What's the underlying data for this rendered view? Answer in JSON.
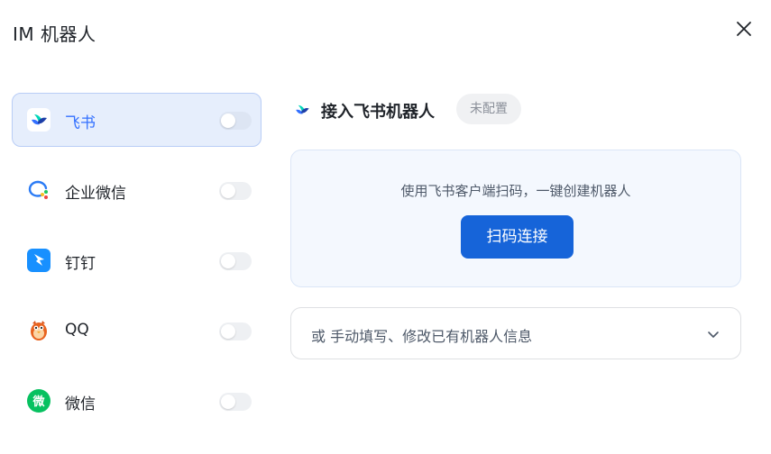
{
  "dialog": {
    "title": "IM 机器人",
    "close_icon": "close-icon"
  },
  "sidebar": {
    "items": [
      {
        "label": "飞书",
        "icon": "feishu-logo-icon",
        "active": true,
        "enabled": false
      },
      {
        "label": "企业微信",
        "icon": "wecom-logo-icon",
        "active": false,
        "enabled": false
      },
      {
        "label": "钉钉",
        "icon": "dingtalk-logo-icon",
        "active": false,
        "enabled": false
      },
      {
        "label": "QQ",
        "icon": "qq-penguin-icon",
        "active": false,
        "enabled": false
      },
      {
        "label": "微信",
        "icon": "wechat-logo-icon",
        "active": false,
        "enabled": false
      }
    ]
  },
  "main": {
    "title": "接入飞书机器人",
    "status": "未配置",
    "scan_hint": "使用飞书客户端扫码，一键创建机器人",
    "scan_button": "扫码连接",
    "manual_label": "或 手动填写、修改已有机器人信息"
  },
  "colors": {
    "accent": "#3370ff",
    "primary_button": "#1664d9",
    "active_item_bg": "#e6eefc",
    "card_bg": "#f4f8fe"
  }
}
